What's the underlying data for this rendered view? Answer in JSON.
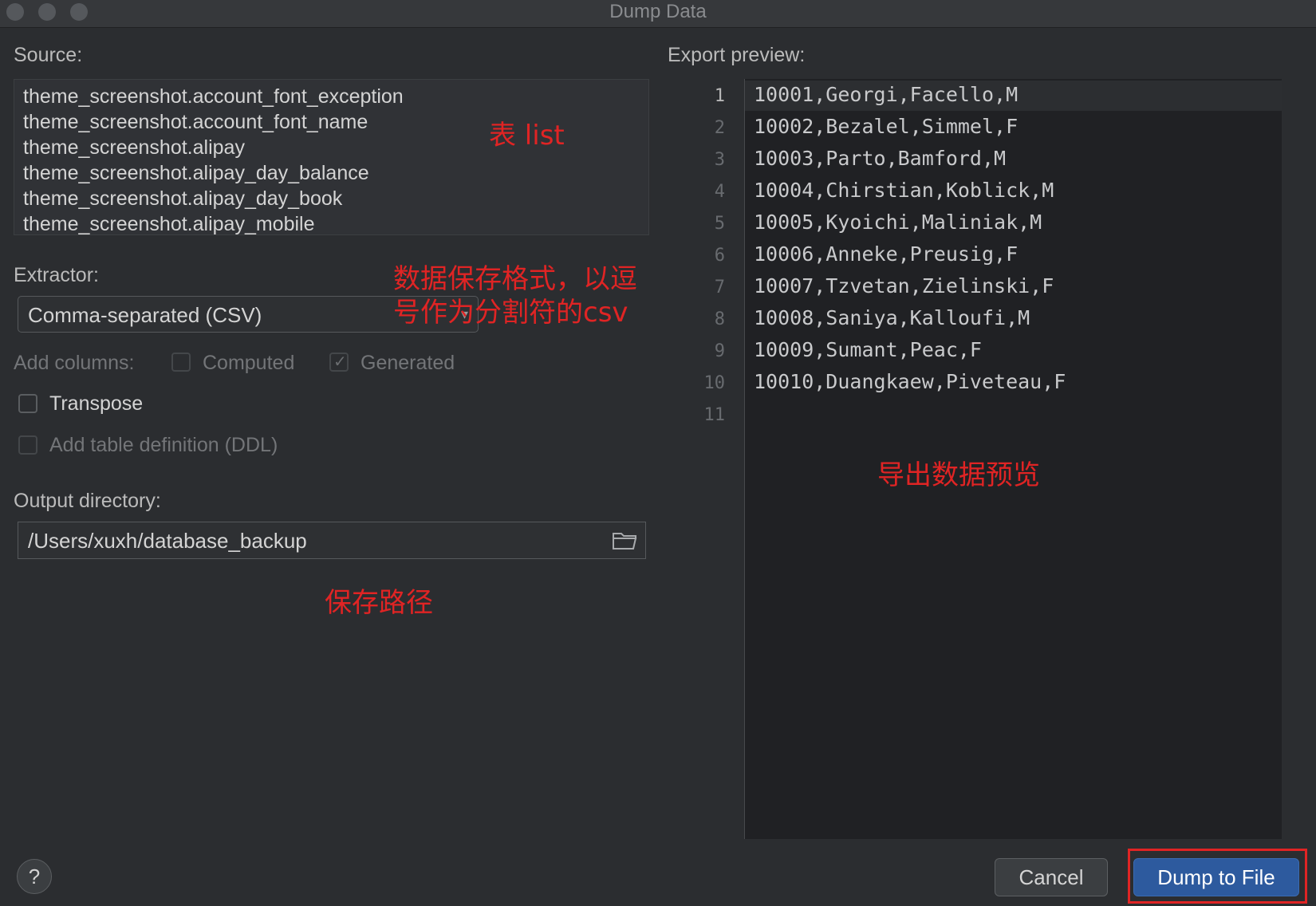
{
  "window": {
    "title": "Dump Data"
  },
  "source": {
    "label": "Source:",
    "items": [
      "theme_screenshot.account_font_exception",
      "theme_screenshot.account_font_name",
      "theme_screenshot.alipay",
      "theme_screenshot.alipay_day_balance",
      "theme_screenshot.alipay_day_book",
      "theme_screenshot.alipay_mobile"
    ]
  },
  "extractor": {
    "label": "Extractor:",
    "value": "Comma-separated (CSV)"
  },
  "add_columns": {
    "label": "Add columns:",
    "computed": {
      "label": "Computed",
      "checked": false
    },
    "generated": {
      "label": "Generated",
      "checked": true
    }
  },
  "options": {
    "transpose": {
      "label": "Transpose",
      "checked": false
    },
    "ddl": {
      "label": "Add table definition (DDL)",
      "checked": false
    }
  },
  "output": {
    "label": "Output directory:",
    "value": "/Users/xuxh/database_backup",
    "icon": "folder-icon"
  },
  "preview": {
    "label": "Export preview:",
    "line_numbers": [
      "1",
      "2",
      "3",
      "4",
      "5",
      "6",
      "7",
      "8",
      "9",
      "10",
      "11"
    ],
    "lines": [
      "10001,Georgi,Facello,M",
      "10002,Bezalel,Simmel,F",
      "10003,Parto,Bamford,M",
      "10004,Chirstian,Koblick,M",
      "10005,Kyoichi,Maliniak,M",
      "10006,Anneke,Preusig,F",
      "10007,Tzvetan,Zielinski,F",
      "10008,Saniya,Kalloufi,M",
      "10009,Sumant,Peac,F",
      "10010,Duangkaew,Piveteau,F",
      ""
    ]
  },
  "annotations": {
    "table_list": "表 list",
    "format_line1": "数据保存格式，以逗",
    "format_line2": "号作为分割符的csv",
    "save_path": "保存路径",
    "export_preview": "导出数据预览"
  },
  "buttons": {
    "help": "?",
    "cancel": "Cancel",
    "dump": "Dump to File"
  },
  "colors": {
    "background": "#2b2d30",
    "annotation": "#e02424",
    "primary_button": "#2d5a9e"
  }
}
